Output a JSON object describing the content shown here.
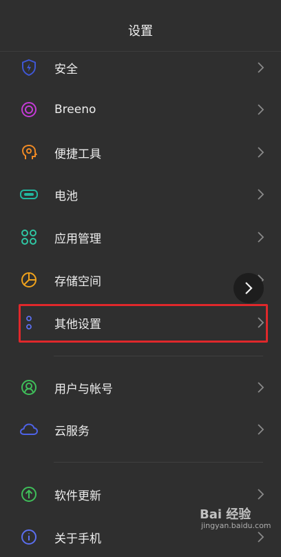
{
  "header": {
    "title": "设置"
  },
  "items": [
    {
      "label": "安全",
      "icon": "shield-icon"
    },
    {
      "label": "Breeno",
      "icon": "breeno-ring-icon"
    },
    {
      "label": "便捷工具",
      "icon": "head-gear-icon"
    },
    {
      "label": "电池",
      "icon": "battery-icon"
    },
    {
      "label": "应用管理",
      "icon": "app-grid-icon"
    },
    {
      "label": "存储空间",
      "icon": "pie-chart-icon"
    },
    {
      "label": "其他设置",
      "icon": "dots-icon"
    },
    {
      "label": "用户与帐号",
      "icon": "user-circle-icon"
    },
    {
      "label": "云服务",
      "icon": "cloud-icon"
    },
    {
      "label": "软件更新",
      "icon": "upgrade-arrow-icon"
    },
    {
      "label": "关于手机",
      "icon": "info-icon"
    }
  ],
  "watermark": {
    "brand": "Bai 经验",
    "url": "jingyan.baidu.com"
  },
  "colors": {
    "background": "#2f2f2f",
    "highlight": "#e0282b",
    "shield": "#3f57d6",
    "breeno": "#c43bd6",
    "tools": "#f08a24",
    "battery": "#22b7a0",
    "apps": "#2fc7a4",
    "storage": "#f0a21c",
    "other": "#5b6ff0",
    "user": "#3fbf5a",
    "cloud": "#4e63e8",
    "update": "#3fbf5a"
  }
}
